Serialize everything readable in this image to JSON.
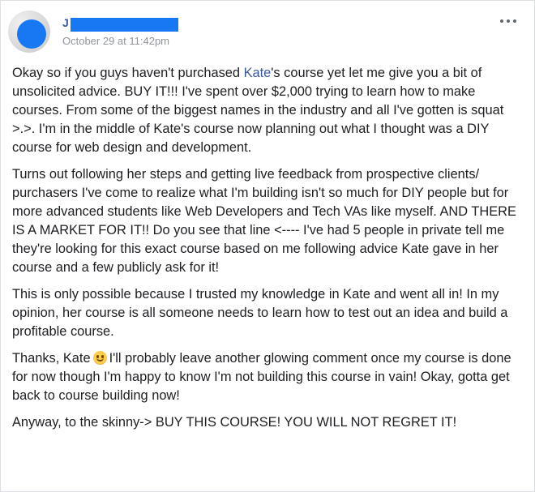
{
  "post": {
    "author": {
      "name": "J",
      "name_redacted": true
    },
    "timestamp": "October 29 at 11:42pm",
    "more_icon": "more-horizontal-icon",
    "mention": "Kate",
    "paragraphs": {
      "p1_before": "Okay so if you guys haven't purchased ",
      "p1_after": "'s course yet let me give you a bit of unsolicited advice. BUY IT!!! I've spent over $2,000 trying to learn how to make courses. From some of the biggest names in the industry and all I've gotten is squat >.>. I'm in the middle of Kate's course now planning out what I thought was a DIY course for web design and development.",
      "p2": "Turns out following her steps and getting live feedback from prospective clients/ purchasers I've come to realize what I'm building isn't so much for DIY people but for more advanced students like Web Developers and Tech VAs like myself. AND THERE IS A MARKET FOR IT!! Do you see that line <---- I've had 5 people in private tell me they're looking for this exact course based on me following advice Kate gave in her course and a few publicly ask for it!",
      "p3": "This is only possible because I trusted my knowledge in Kate and went all in! In my opinion, her course is all someone needs to learn how to test out an idea and build a profitable course.",
      "p4_before": "Thanks, Kate",
      "p4_emoji": "smiley-emoji-icon",
      "p4_after": "I'll probably leave another glowing comment once my course is done for now though I'm happy to know I'm not building this course in vain! Okay, gotta get back to course building now!",
      "p5": "Anyway, to the skinny-> BUY THIS COURSE! YOU WILL NOT REGRET IT!"
    }
  },
  "colors": {
    "link": "#385898",
    "redaction": "#1877f2",
    "meta_text": "#90949c",
    "body_text": "#1c1e21"
  }
}
